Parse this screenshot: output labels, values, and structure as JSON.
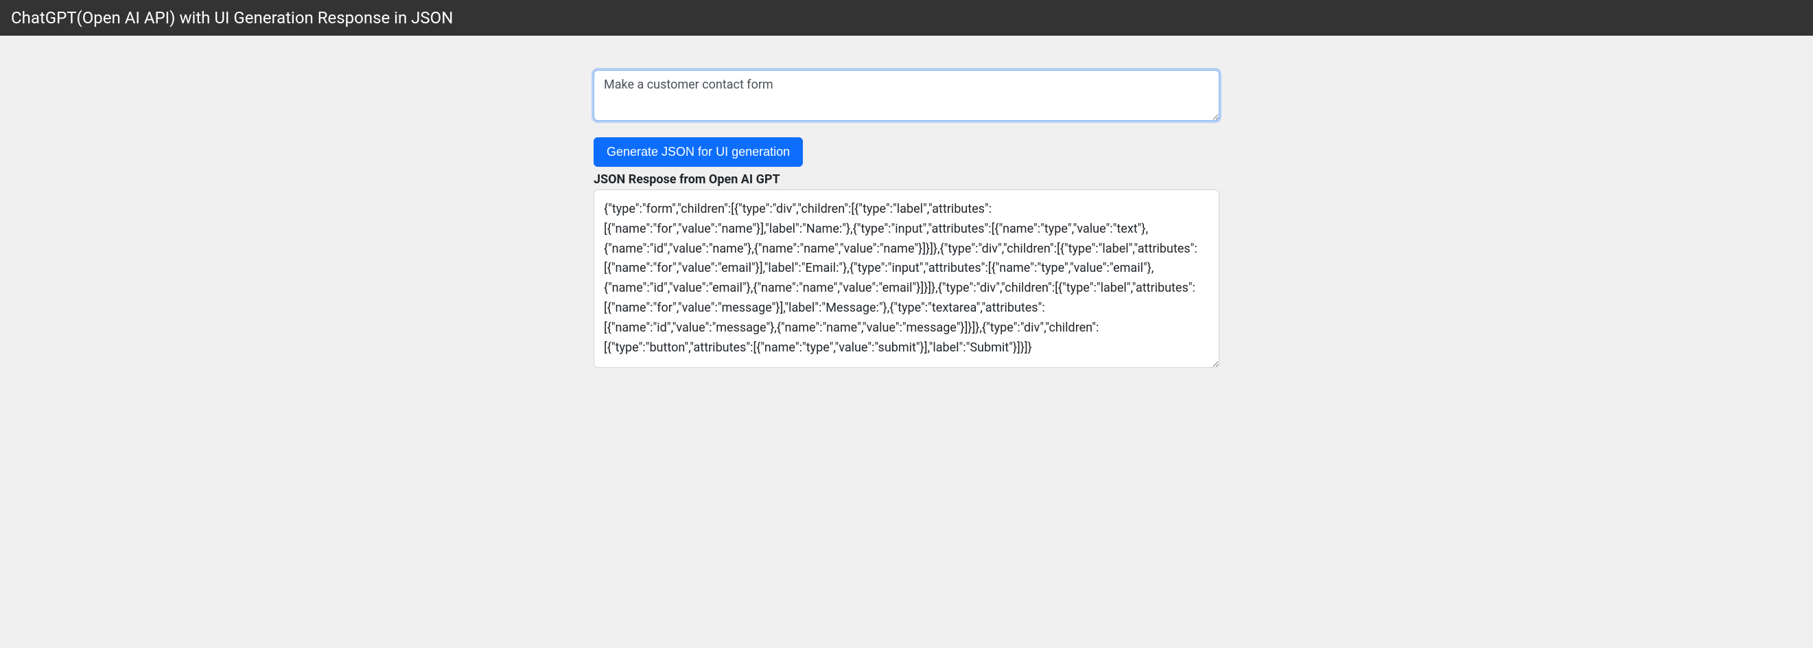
{
  "header": {
    "title": "ChatGPT(Open AI API) with UI Generation Response in JSON"
  },
  "prompt": {
    "value": "Make a customer contact form"
  },
  "button": {
    "generate_label": "Generate JSON for UI generation"
  },
  "response": {
    "label": "JSON Respose from Open AI GPT",
    "value": "{\"type\":\"form\",\"children\":[{\"type\":\"div\",\"children\":[{\"type\":\"label\",\"attributes\":[{\"name\":\"for\",\"value\":\"name\"}],\"label\":\"Name:\"},{\"type\":\"input\",\"attributes\":[{\"name\":\"type\",\"value\":\"text\"},{\"name\":\"id\",\"value\":\"name\"},{\"name\":\"name\",\"value\":\"name\"}]}]},{\"type\":\"div\",\"children\":[{\"type\":\"label\",\"attributes\":[{\"name\":\"for\",\"value\":\"email\"}],\"label\":\"Email:\"},{\"type\":\"input\",\"attributes\":[{\"name\":\"type\",\"value\":\"email\"},{\"name\":\"id\",\"value\":\"email\"},{\"name\":\"name\",\"value\":\"email\"}]}]},{\"type\":\"div\",\"children\":[{\"type\":\"label\",\"attributes\":[{\"name\":\"for\",\"value\":\"message\"}],\"label\":\"Message:\"},{\"type\":\"textarea\",\"attributes\":[{\"name\":\"id\",\"value\":\"message\"},{\"name\":\"name\",\"value\":\"message\"}]}]},{\"type\":\"div\",\"children\":[{\"type\":\"button\",\"attributes\":[{\"name\":\"type\",\"value\":\"submit\"}],\"label\":\"Submit\"}]}]}"
  }
}
